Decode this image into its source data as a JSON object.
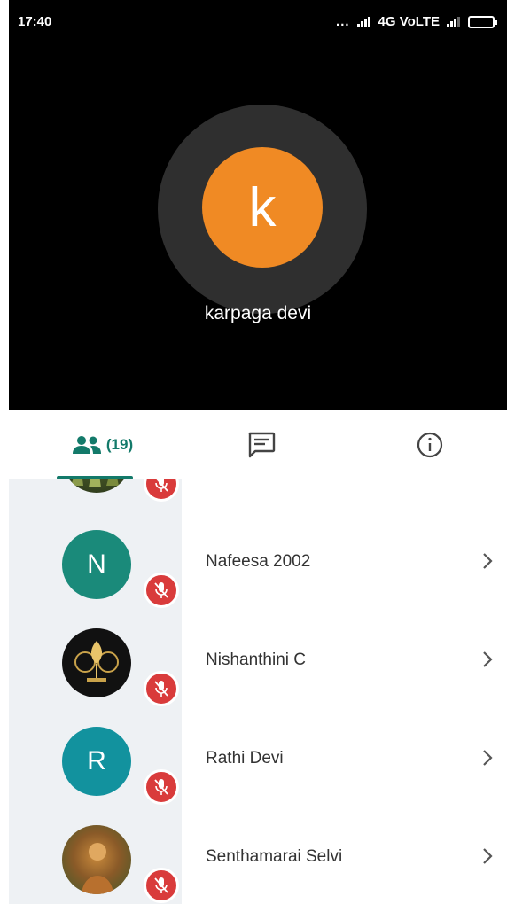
{
  "status_bar": {
    "time": "17:40",
    "dots": "...",
    "network": "4G VoLTE"
  },
  "speaker": {
    "initial": "k",
    "name": "karpaga devi",
    "avatar_color": "#f08a24"
  },
  "tabs": {
    "people_count": "(19)",
    "people_icon": "people-icon",
    "chat_icon": "chat-icon",
    "info_icon": "info-icon",
    "accent_color": "#137a6a"
  },
  "participants": [
    {
      "name": "",
      "initial": "",
      "avatar_type": "photo-foliage",
      "muted": true
    },
    {
      "name": "Nafeesa 2002",
      "initial": "N",
      "avatar_type": "letter",
      "avatar_color": "#1a8a7a",
      "muted": true
    },
    {
      "name": "Nishanthini C",
      "initial": "",
      "avatar_type": "photo-emblem",
      "muted": true
    },
    {
      "name": "Rathi Devi",
      "initial": "R",
      "avatar_type": "letter",
      "avatar_color": "#12929e",
      "muted": true
    },
    {
      "name": "Senthamarai Selvi",
      "initial": "",
      "avatar_type": "photo-portrait",
      "muted": true
    }
  ],
  "mute_badge_color": "#d93b3b"
}
